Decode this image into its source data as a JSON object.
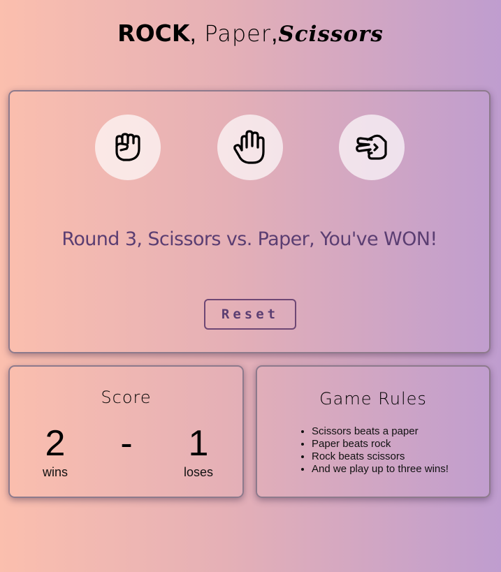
{
  "header": {
    "title_rock": "ROCK",
    "title_sep1": ", ",
    "title_paper": "Paper",
    "title_sep2": ",",
    "title_scissors": "Scissors"
  },
  "game": {
    "choices": [
      {
        "name": "rock",
        "icon": "fist-icon"
      },
      {
        "name": "paper",
        "icon": "open-hand-icon"
      },
      {
        "name": "scissors",
        "icon": "scissors-hand-icon"
      }
    ],
    "message": "Round 3, Scissors vs. Paper, You've WON!",
    "reset_label": "Reset"
  },
  "score": {
    "title": "Score",
    "wins": "2",
    "separator": "-",
    "loses": "1",
    "wins_label": "wins",
    "loses_label": "loses"
  },
  "rules": {
    "title": "Game Rules",
    "items": [
      "Scissors beats a paper",
      "Paper beats rock",
      "Rock beats scissors",
      "And we play up to three wins!"
    ]
  },
  "colors": {
    "accent": "#5b3e72",
    "gradient_start": "#fbbfae",
    "gradient_end": "#bf9dcf"
  }
}
